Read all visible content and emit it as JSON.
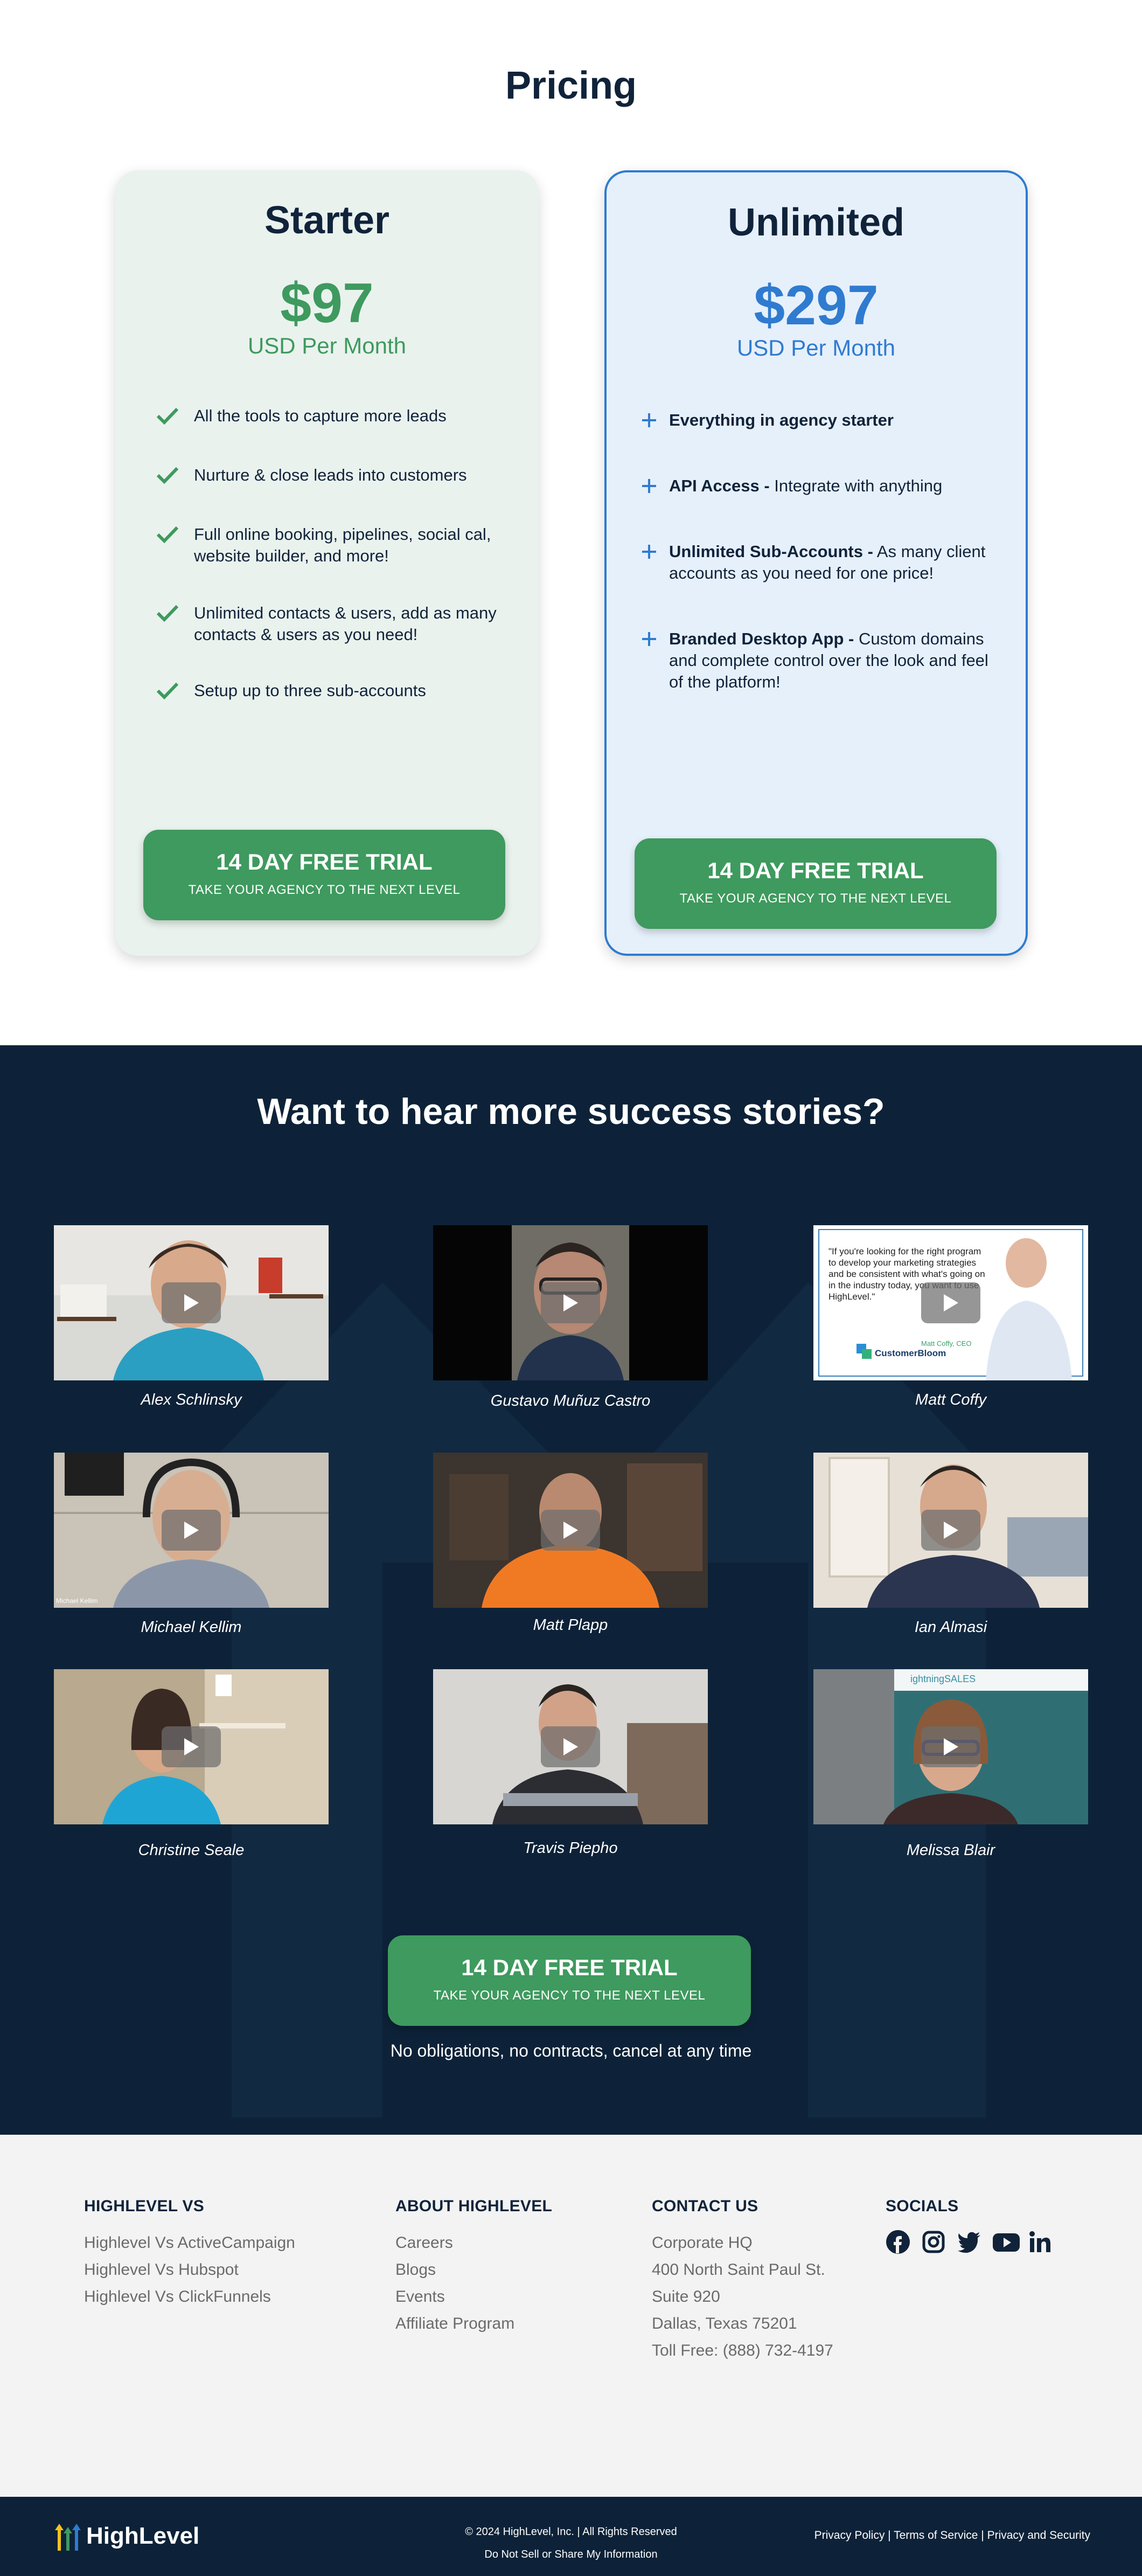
{
  "pricing": {
    "title": "Pricing",
    "starter": {
      "name": "Starter",
      "price": "$97",
      "period": "USD Per Month",
      "features": [
        "All the tools to capture more leads",
        "Nurture & close leads into customers",
        "Full online booking, pipelines, social cal, website builder, and more!",
        "Unlimited contacts & users, add as many contacts & users as you need!",
        "Setup up to three sub-accounts"
      ],
      "cta_main": "14 DAY FREE TRIAL",
      "cta_sub": "TAKE YOUR AGENCY TO THE NEXT LEVEL"
    },
    "unlimited": {
      "name": "Unlimited",
      "price": "$297",
      "period": "USD Per Month",
      "features": [
        {
          "bold": "Everything in agency starter",
          "text": ""
        },
        {
          "bold": "API Access -",
          "text": " Integrate with anything"
        },
        {
          "bold": "Unlimited Sub-Accounts -",
          "text": " As many client accounts as you need for one price!"
        },
        {
          "bold": "Branded Desktop App -",
          "text": " Custom domains and complete control over the look and feel of the platform!"
        }
      ],
      "cta_main": "14 DAY FREE TRIAL",
      "cta_sub": "TAKE YOUR AGENCY TO THE NEXT LEVEL"
    }
  },
  "stories": {
    "title": "Want to hear more success stories?",
    "videos": [
      {
        "name": "Alex Schlinsky"
      },
      {
        "name": "Gustavo Muñuz Castro"
      },
      {
        "name": "Matt Coffy",
        "quote": "\"If you're looking for the right program to develop your marketing strategies and be consistent with what's going on in the industry today, you want to use HighLevel.\"",
        "caption": "Matt Coffy, CEO",
        "brand": "CustomerBloom"
      },
      {
        "name": "Michael Kellim",
        "overlay": "Michael Kellim"
      },
      {
        "name": "Matt Plapp"
      },
      {
        "name": "Ian Almasi"
      },
      {
        "name": "Christine Seale"
      },
      {
        "name": "Travis Piepho"
      },
      {
        "name": "Melissa Blair",
        "sign": "ightningSALES"
      }
    ],
    "cta_main": "14 DAY FREE TRIAL",
    "cta_sub": "TAKE YOUR AGENCY TO THE NEXT LEVEL",
    "note": "No obligations, no contracts, cancel at any time"
  },
  "footer": {
    "col1": {
      "title": "HIGHLEVEL VS",
      "links": [
        "Highlevel Vs ActiveCampaign",
        "Highlevel Vs Hubspot",
        "Highlevel Vs ClickFunnels"
      ]
    },
    "col2": {
      "title": "ABOUT HIGHLEVEL",
      "links": [
        "Careers",
        "Blogs",
        "Events",
        "Affiliate Program"
      ]
    },
    "col3": {
      "title": "CONTACT US",
      "lines": [
        "Corporate HQ",
        "400 North Saint Paul St.",
        "Suite 920",
        "Dallas, Texas 75201",
        "Toll Free: (888) 732-4197"
      ]
    },
    "col4": {
      "title": "SOCIALS",
      "icons": [
        "facebook-icon",
        "instagram-icon",
        "twitter-icon",
        "youtube-icon",
        "linkedin-icon"
      ]
    }
  },
  "bottom": {
    "logo": "HighLevel",
    "copyright": "© 2024 HighLevel, Inc. | All Rights Reserved",
    "privacy_info": "Do Not Sell or Share My Information",
    "legal": "Privacy Policy | Terms of Service | Privacy and Security"
  },
  "colors": {
    "green": "#3e9a5e",
    "blue": "#2f7bd0",
    "navy": "#0d2238"
  }
}
